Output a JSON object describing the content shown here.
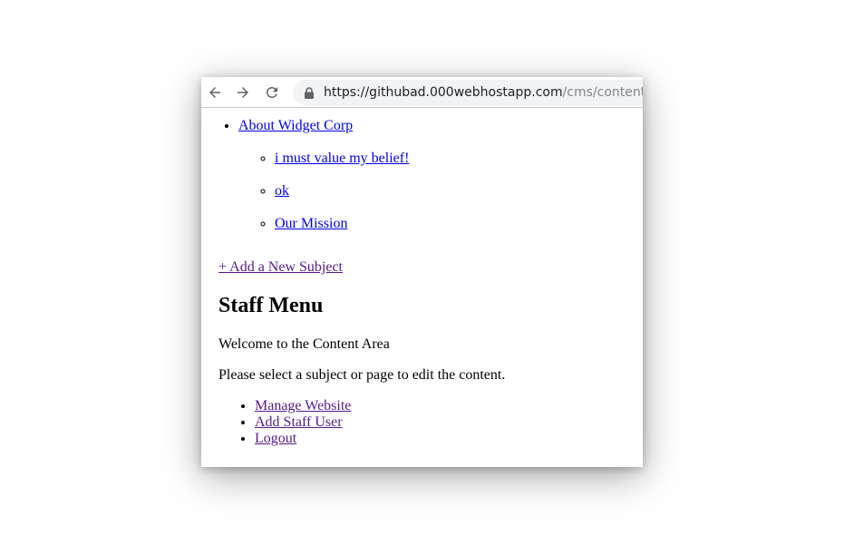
{
  "browser": {
    "url_host": "https://githubad.000webhostapp.com",
    "url_path": "/cms/content.php"
  },
  "navigation": {
    "subjects": [
      {
        "label": "About Widget Corp",
        "pages": [
          {
            "label": "i must value my belief!"
          },
          {
            "label": "ok"
          },
          {
            "label": "Our Mission"
          }
        ]
      }
    ],
    "add_subject_label": "+ Add a New Subject"
  },
  "main": {
    "title": "Staff Menu",
    "welcome": "Welcome to the Content Area",
    "instruction": "Please select a subject or page to edit the content.",
    "links": [
      {
        "label": "Manage Website"
      },
      {
        "label": "Add Staff User"
      },
      {
        "label": "Logout"
      }
    ]
  },
  "colors": {
    "link": "#0000ee",
    "visited_link": "#551a8b",
    "omnibox_bg": "#f1f3f4"
  }
}
